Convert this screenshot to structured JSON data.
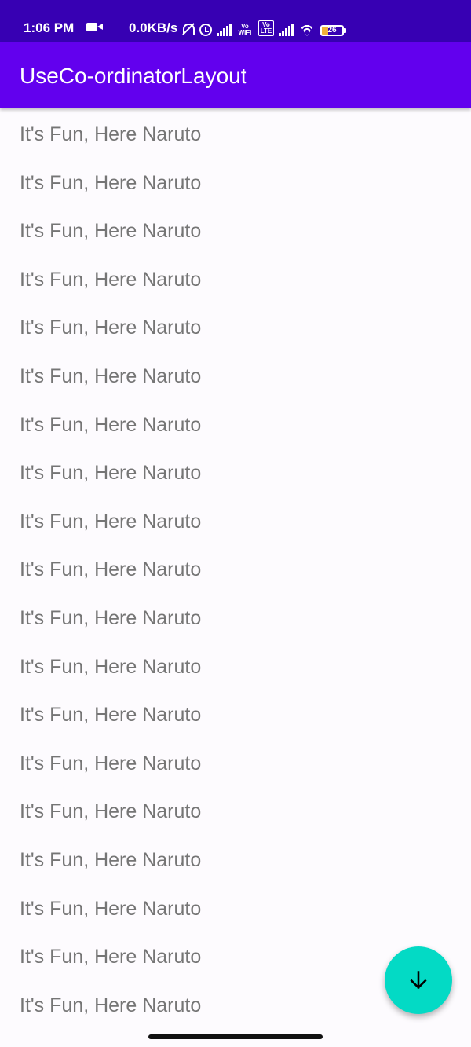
{
  "status_bar": {
    "time": "1:06 PM",
    "network_speed": "0.0KB/s",
    "volte_label_1": "Vo WiFi",
    "volte_label_2": "Vo LTE",
    "battery_level": "26",
    "icons": [
      "video-camera-icon",
      "notifications-off-icon",
      "alarm-icon",
      "signal-icon",
      "vowifi-icon",
      "volte-icon",
      "signal-icon",
      "wifi-icon",
      "battery-icon"
    ],
    "background_color": "#3700b3"
  },
  "app_bar": {
    "title": "UseCo-ordinatorLayout",
    "background_color": "#6200ee"
  },
  "list": {
    "items": [
      "It's Fun, Here Naruto",
      "It's Fun, Here Naruto",
      "It's Fun, Here Naruto",
      "It's Fun, Here Naruto",
      "It's Fun, Here Naruto",
      "It's Fun, Here Naruto",
      "It's Fun, Here Naruto",
      "It's Fun, Here Naruto",
      "It's Fun, Here Naruto",
      "It's Fun, Here Naruto",
      "It's Fun, Here Naruto",
      "It's Fun, Here Naruto",
      "It's Fun, Here Naruto",
      "It's Fun, Here Naruto",
      "It's Fun, Here Naruto",
      "It's Fun, Here Naruto",
      "It's Fun, Here Naruto",
      "It's Fun, Here Naruto",
      "It's Fun, Here Naruto"
    ],
    "text_color": "#757575"
  },
  "fab": {
    "icon": "arrow-down-icon",
    "background_color": "#03dac5"
  }
}
